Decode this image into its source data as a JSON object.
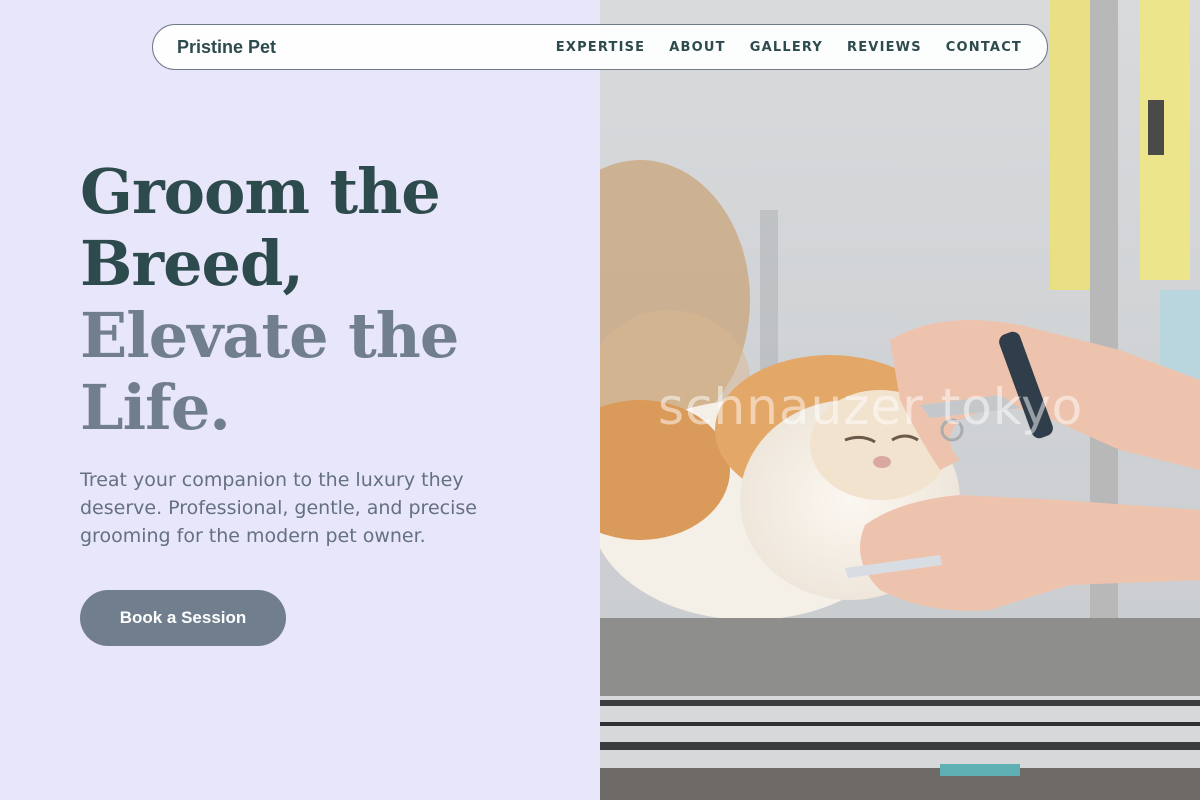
{
  "navbar": {
    "brand": "Pristine Pet",
    "links": [
      "EXPERTISE",
      "ABOUT",
      "GALLERY",
      "REVIEWS",
      "CONTACT"
    ]
  },
  "hero": {
    "title_lines": [
      "Groom the",
      "Breed,",
      "Elevate the",
      "Life."
    ],
    "subtitle": "Treat your companion to the luxury they deserve. Professional, gentle, and precise grooming for the modern pet owner.",
    "cta_label": "Book a Session"
  },
  "photo": {
    "watermark": "schnauzer tokyo"
  },
  "colors": {
    "background": "#e8e6fa",
    "heading_dark": "#2d4a4d",
    "heading_muted": "#717e8e",
    "button": "#717e8e"
  }
}
